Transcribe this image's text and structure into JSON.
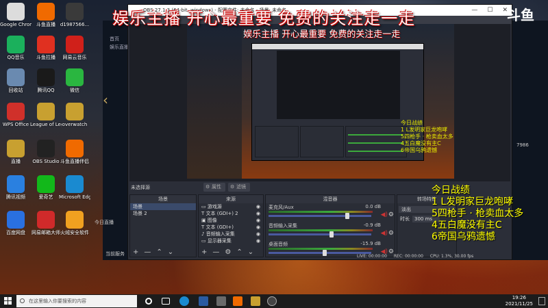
{
  "overlay_title": "娱乐主播 开心最重要 免费的关注走一走",
  "right_logo": "斗鱼",
  "desktop_icons": [
    {
      "label": "Google Chrome",
      "color": "#dcdcdc"
    },
    {
      "label": "斗鱼直播",
      "color": "#f06a00"
    },
    {
      "label": "d1987566...",
      "color": "#3a3a3a"
    },
    {
      "label": "QQ音乐",
      "color": "#1bb05c"
    },
    {
      "label": "斗鱼拉播",
      "color": "#e03020"
    },
    {
      "label": "网易云音乐",
      "color": "#d0201a"
    },
    {
      "label": "回收站",
      "color": "#6a8ab0"
    },
    {
      "label": "腾讯QQ",
      "color": "#1a1a1a"
    },
    {
      "label": "微信",
      "color": "#2ab640"
    },
    {
      "label": "WPS Office",
      "color": "#d0302a"
    },
    {
      "label": "League of Legends",
      "color": "#c8a030"
    },
    {
      "label": "overwatch",
      "color": "#c8a030"
    },
    {
      "label": "直播",
      "color": "#c8a030"
    },
    {
      "label": "OBS Studio",
      "color": "#222222"
    },
    {
      "label": "斗鱼直播伴侣",
      "color": "#f06a00"
    },
    {
      "label": "腾讯视频",
      "color": "#2a80e0"
    },
    {
      "label": "爱奇艺",
      "color": "#12b81a"
    },
    {
      "label": "Microsoft Edge",
      "color": "#1a8ad0"
    },
    {
      "label": "百度网盘",
      "color": "#2a70e0"
    },
    {
      "label": "网易邮箱大师",
      "color": "#d02a2a"
    },
    {
      "label": "火绒安全软件",
      "color": "#f0a020"
    }
  ],
  "site": {
    "nav_home": "首页",
    "nav_sub": "娱乐直播",
    "side_text": "今日直播",
    "num_right": "7986",
    "bottom_text": "当前服务"
  },
  "obs": {
    "title": "OBS 27.1.3 (64-bit, windows) - 配置文件: 未命名 - 场景: 未命名",
    "no_source": "未选择源",
    "btn_properties": "属性",
    "btn_filters": "滤镜",
    "scenes_header": "场景",
    "scenes": [
      "场景",
      "场景 2"
    ],
    "sources_header": "来源",
    "sources": [
      "游戏源",
      "文本 (GDI+) 2",
      "图像",
      "文本 (GDI+)",
      "音频输入采集",
      "显示器采集"
    ],
    "mixer_header": "混音器",
    "mixer": [
      {
        "name": "麦克风/Aux",
        "db": "0.0 dB",
        "level": 0.78
      },
      {
        "name": "音频输入采集",
        "db": "-0.9 dB",
        "level": 0.62
      },
      {
        "name": "桌面音频",
        "db": "-15.9 dB",
        "level": 0.55
      }
    ],
    "transitions_header": "转场特效",
    "transition_type": "淡出",
    "duration_label": "时长",
    "duration_value": "300 ms",
    "status": {
      "live": "LIVE: 00:00:00",
      "rec": "REC: 00:00:00",
      "cpu": "CPU: 1.3%, 30.00 fps"
    }
  },
  "stats": {
    "title": "今日战绩",
    "lines": [
      "1 L发明家巨龙咆哮",
      "5四枪手 · 枪卖血太多",
      "4五白魔没有主C",
      "6帝国乌鸦遗憾"
    ]
  },
  "taskbar": {
    "search_placeholder": "在这里输入你要搜索的内容",
    "time": "19:26",
    "date": "2021/11/25"
  }
}
